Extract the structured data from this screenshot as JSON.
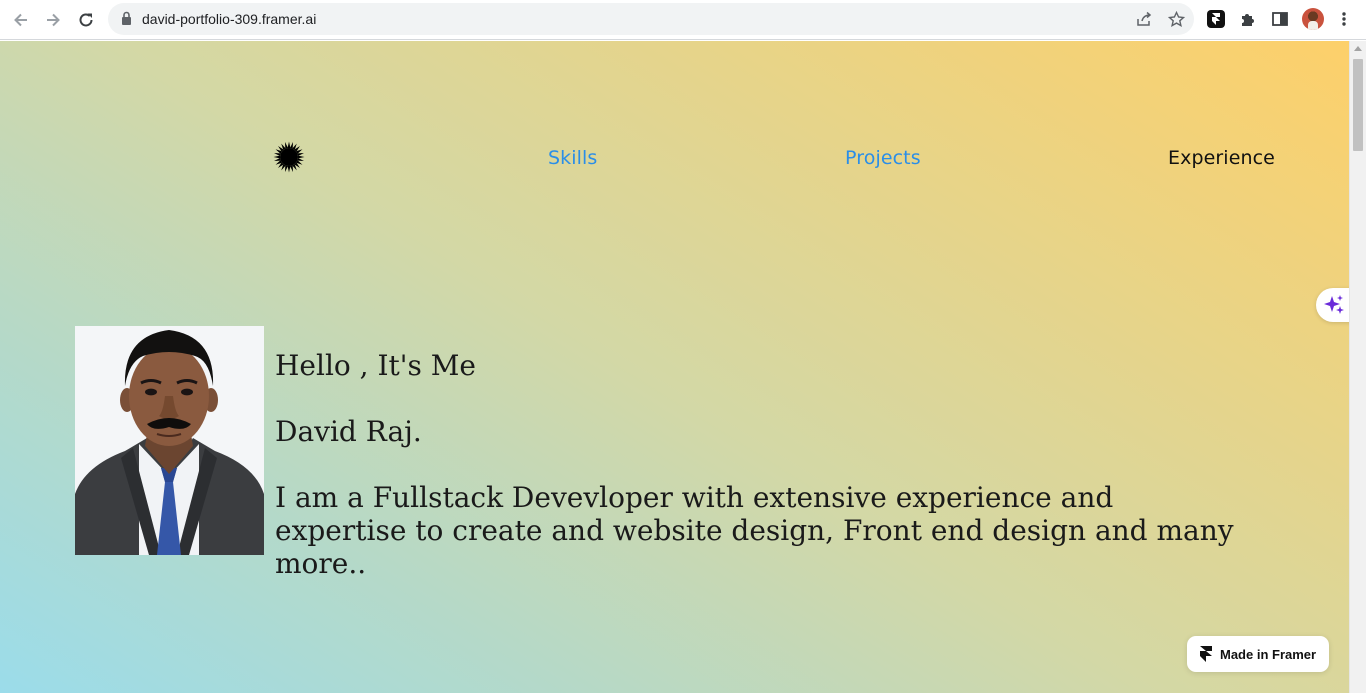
{
  "browser": {
    "url": "david-portfolio-309.framer.ai"
  },
  "site_nav": {
    "links": [
      {
        "label": "Skills",
        "color": "#2a8ee8"
      },
      {
        "label": "Projects",
        "color": "#2a8ee8"
      },
      {
        "label": "Experience",
        "color": "#111111"
      }
    ]
  },
  "hero": {
    "greeting": "Hello , It's Me",
    "name": "David Raj.",
    "bio": "I am a Fullstack Devevloper with extensive experience and expertise to create and website design, Front end design and many more.."
  },
  "badge": {
    "label": "Made in Framer"
  },
  "colors": {
    "link_blue": "#2a8ee8",
    "gradient_start": "#9bdcea",
    "gradient_end": "#fdd06a",
    "ai_sparkle": "#6b2bd9"
  }
}
